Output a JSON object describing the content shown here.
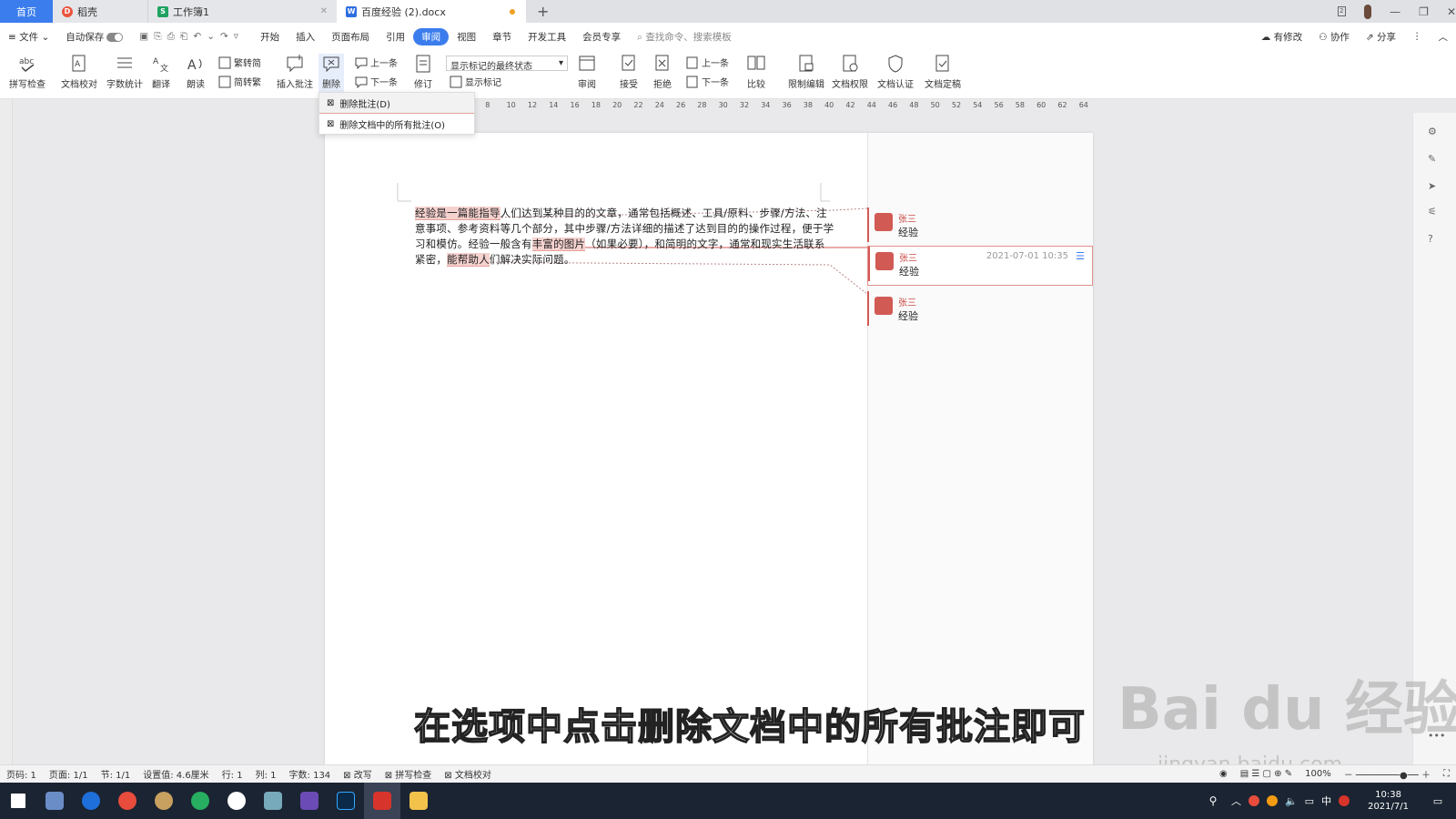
{
  "tabs": [
    {
      "label": "首页"
    },
    {
      "label": "稻壳"
    },
    {
      "label": "工作簿1"
    },
    {
      "label": "百度经验 (2).docx"
    }
  ],
  "menu": {
    "file": "文件",
    "autosave": "自动保存",
    "items": [
      "开始",
      "插入",
      "页面布局",
      "引用",
      "审阅",
      "视图",
      "章节",
      "开发工具",
      "会员专享"
    ],
    "active": "审阅",
    "search_placeholder": "查找命令、搜索模板",
    "right": [
      "有修改",
      "协作",
      "分享"
    ]
  },
  "ribbon": {
    "spell": "拼写检查",
    "proof": "文档校对",
    "wordcount": "字数统计",
    "translate": "翻译",
    "read": "朗读",
    "trad": "繁转简",
    "simp": "简转繁",
    "insert_comment": "插入批注",
    "delete": "删除",
    "prev1": "上一条",
    "next1": "下一条",
    "revise": "修订",
    "markup_state": "显示标记的最终状态",
    "show_markup": "显示标记",
    "review": "审阅",
    "accept": "接受",
    "reject": "拒绝",
    "prev2": "上一条",
    "next2": "下一条",
    "compare": "比较",
    "restrict": "限制编辑",
    "permission": "文档权限",
    "certify": "文档认证",
    "finalize": "文档定稿"
  },
  "dropdown": {
    "item1": "删除批注(D)",
    "item2": "删除文档中的所有批注(O)"
  },
  "ruler_ticks": [
    "6",
    "8",
    "10",
    "12",
    "14",
    "16",
    "18",
    "20",
    "22",
    "24",
    "26",
    "28",
    "30",
    "32",
    "34",
    "36",
    "38",
    "40",
    "42",
    "44",
    "46",
    "48",
    "50",
    "52",
    "54",
    "56",
    "58",
    "60",
    "62",
    "64"
  ],
  "doc": {
    "seg1": "经验是一篇能指导",
    "seg2": "人们达到某种目的的文章，通常包括概述、工具/原料、步骤/方法、注意事项、参考资料等几个部分，其中步骤/方法详细的描述了达到目的的操作过程，便于学习和模仿。经验一般含有",
    "seg3": "丰富的图片",
    "seg4": "（如果必要），和简明的文字，通常和现实生活联系紧密，",
    "seg5": "能帮助人",
    "seg6": "们解决实际问题。"
  },
  "comments": [
    {
      "author": "张三",
      "text": "经验",
      "time": ""
    },
    {
      "author": "张三",
      "text": "经验",
      "time": "2021-07-01 10:35"
    },
    {
      "author": "张三",
      "text": "经验",
      "time": ""
    }
  ],
  "status": {
    "page": "页码: 1",
    "pages": "页面: 1/1",
    "section": "节: 1/1",
    "setting": "设置值: 4.6厘米",
    "row": "行: 1",
    "col": "列: 1",
    "words": "字数: 134",
    "revise": "改写",
    "spell": "拼写检查",
    "proof": "文档校对",
    "zoom": "100%"
  },
  "subtitle": "在选项中点击删除文档中的所有批注即可",
  "watermark": "Bai du 经验",
  "watermark_url": "jingyan.baidu.com",
  "clock": {
    "time": "10:38",
    "date": "2021/7/1"
  },
  "tray_ime": "中",
  "colors": {
    "accent": "#3b7ded",
    "comment": "#d25a55",
    "highlight": "#f6d2cf"
  }
}
